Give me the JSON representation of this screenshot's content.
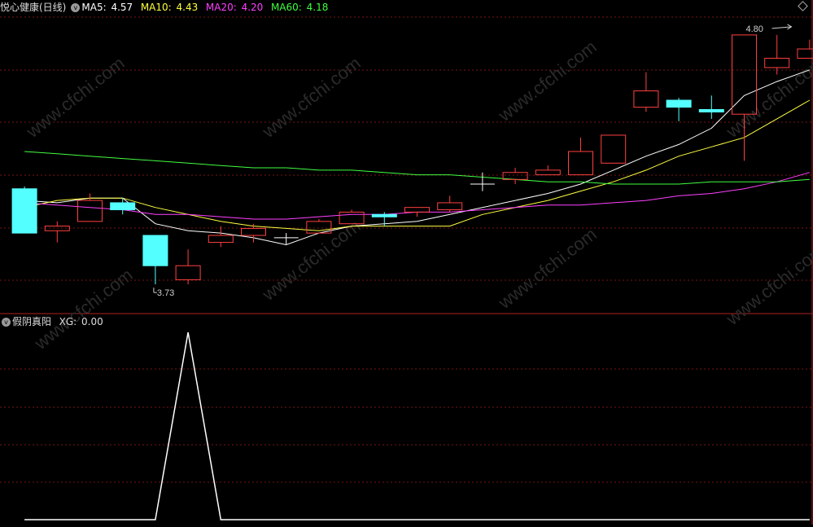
{
  "header": {
    "title": "悦心健康(日线)",
    "ma5_label": "MA5:",
    "ma5_value": "4.57",
    "ma10_label": "MA10:",
    "ma10_value": "4.43",
    "ma20_label": "MA20:",
    "ma20_value": "4.20",
    "ma60_label": "MA60:",
    "ma60_value": "4.18"
  },
  "indicator": {
    "title": "假阴真阳",
    "xg_label": "XG:",
    "xg_value": "0.00"
  },
  "colors": {
    "up": "#ff4040",
    "down": "#54ffff",
    "ma5": "#ffffff",
    "ma10": "#ffff40",
    "ma20": "#ff40ff",
    "ma60": "#40ff40",
    "grid": "#7a1414",
    "separator": "#b02020"
  },
  "watermark": "www.cfchi.com",
  "chart_data": {
    "type": "candlestick",
    "price_range": [
      3.65,
      4.88
    ],
    "annotations": [
      {
        "text": "4.80",
        "index": 22,
        "value": 4.8
      },
      {
        "text": "3.73",
        "index": 4,
        "value": 3.73
      }
    ],
    "candles": [
      {
        "open": 4.14,
        "close": 3.95,
        "high": 4.15,
        "low": 3.95
      },
      {
        "open": 3.96,
        "close": 3.98,
        "high": 4.0,
        "low": 3.91
      },
      {
        "open": 4.0,
        "close": 4.09,
        "high": 4.12,
        "low": 4.0
      },
      {
        "open": 4.08,
        "close": 4.05,
        "high": 4.1,
        "low": 4.03
      },
      {
        "open": 3.94,
        "close": 3.81,
        "high": 3.94,
        "low": 3.73
      },
      {
        "open": 3.75,
        "close": 3.81,
        "high": 3.88,
        "low": 3.73
      },
      {
        "open": 3.91,
        "close": 3.94,
        "high": 3.98,
        "low": 3.89
      },
      {
        "open": 3.94,
        "close": 3.97,
        "high": 3.99,
        "low": 3.91
      },
      {
        "open": 3.93,
        "close": 3.93,
        "high": 3.95,
        "low": 3.9
      },
      {
        "open": 3.95,
        "close": 4.0,
        "high": 4.01,
        "low": 3.95
      },
      {
        "open": 3.99,
        "close": 4.04,
        "high": 4.05,
        "low": 3.99
      },
      {
        "open": 4.03,
        "close": 4.02,
        "high": 4.04,
        "low": 3.98
      },
      {
        "open": 4.04,
        "close": 4.06,
        "high": 4.06,
        "low": 4.02
      },
      {
        "open": 4.05,
        "close": 4.08,
        "high": 4.11,
        "low": 4.04
      },
      {
        "open": 4.16,
        "close": 4.16,
        "high": 4.21,
        "low": 4.13
      },
      {
        "open": 4.18,
        "close": 4.21,
        "high": 4.23,
        "low": 4.16
      },
      {
        "open": 4.2,
        "close": 4.22,
        "high": 4.24,
        "low": 4.2
      },
      {
        "open": 4.2,
        "close": 4.3,
        "high": 4.36,
        "low": 4.2
      },
      {
        "open": 4.25,
        "close": 4.37,
        "high": 4.37,
        "low": 4.25
      },
      {
        "open": 4.49,
        "close": 4.56,
        "high": 4.64,
        "low": 4.47
      },
      {
        "open": 4.52,
        "close": 4.49,
        "high": 4.53,
        "low": 4.43
      },
      {
        "open": 4.48,
        "close": 4.47,
        "high": 4.54,
        "low": 4.44
      },
      {
        "open": 4.46,
        "close": 4.8,
        "high": 4.8,
        "low": 4.26
      },
      {
        "open": 4.66,
        "close": 4.7,
        "high": 4.8,
        "low": 4.63
      },
      {
        "open": 4.7,
        "close": 4.74,
        "high": 4.78,
        "low": 4.7
      }
    ],
    "series": [
      {
        "name": "MA5",
        "values": [
          4.09,
          4.08,
          4.1,
          4.1,
          3.99,
          3.96,
          3.95,
          3.93,
          3.9,
          3.95,
          3.98,
          3.99,
          4.0,
          4.03,
          4.06,
          4.09,
          4.12,
          4.16,
          4.22,
          4.28,
          4.33,
          4.4,
          4.54,
          4.6,
          4.65
        ]
      },
      {
        "name": "MA10",
        "values": [
          4.06,
          4.09,
          4.1,
          4.1,
          4.06,
          4.03,
          4.0,
          3.98,
          3.97,
          3.96,
          3.98,
          3.98,
          3.98,
          3.98,
          4.03,
          4.06,
          4.09,
          4.13,
          4.17,
          4.22,
          4.28,
          4.32,
          4.36,
          4.44,
          4.52
        ]
      },
      {
        "name": "MA20",
        "values": [
          4.08,
          4.07,
          4.06,
          4.05,
          4.03,
          4.03,
          4.02,
          4.01,
          4.01,
          4.02,
          4.03,
          4.03,
          4.04,
          4.04,
          4.05,
          4.06,
          4.07,
          4.07,
          4.08,
          4.09,
          4.11,
          4.12,
          4.14,
          4.17,
          4.21
        ]
      },
      {
        "name": "MA60",
        "values": [
          4.3,
          4.29,
          4.28,
          4.27,
          4.26,
          4.25,
          4.24,
          4.23,
          4.23,
          4.22,
          4.22,
          4.21,
          4.2,
          4.2,
          4.19,
          4.18,
          4.17,
          4.17,
          4.16,
          4.16,
          4.16,
          4.17,
          4.17,
          4.17,
          4.18
        ]
      },
      {
        "name": "XG",
        "values": [
          0,
          0,
          0,
          0,
          0,
          1,
          0,
          0,
          0,
          0,
          0,
          0,
          0,
          0,
          0,
          0,
          0,
          0,
          0,
          0,
          0,
          0,
          0,
          0,
          0
        ]
      }
    ]
  }
}
